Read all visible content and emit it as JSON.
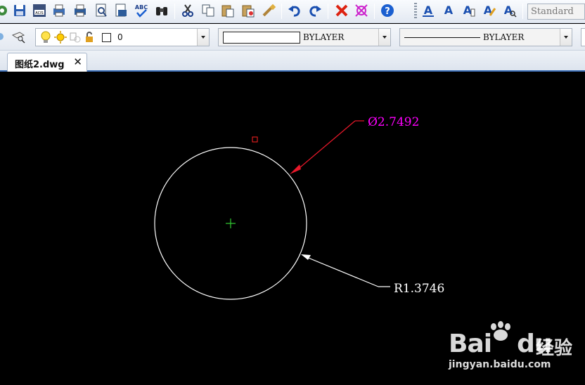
{
  "toolbar": {
    "text_style": "Standard",
    "icons": [
      "new-drawing-icon",
      "save-icon",
      "save-as-icon",
      "print-preview-icon",
      "print-icon",
      "preview-icon",
      "publish-icon",
      "spell-check-icon",
      "find-icon",
      "cut-icon",
      "copy-icon",
      "paste-icon",
      "paste-special-icon",
      "match-properties-icon",
      "undo-icon",
      "redo-icon",
      "erase-icon",
      "pick-icon",
      "help-icon",
      "text-style-icon",
      "text-icon",
      "edit-text-icon",
      "text-format-icon",
      "find-text-icon"
    ],
    "spell_label": "ABC"
  },
  "layer_bar": {
    "layer_name": "0",
    "color_value": "BYLAYER",
    "linetype_value": "BYLAYER"
  },
  "tabs": [
    {
      "label": "图纸2.dwg",
      "close": "✕"
    }
  ],
  "drawing": {
    "diameter_label": "Ø2.7492",
    "radius_label": "R1.3746",
    "circle_color": "#ffffff",
    "diameter_color": "#ff00ff",
    "leader_color": "#e8182a",
    "center_color": "#33cc33",
    "background": "#000000"
  },
  "watermark": {
    "brand": "Bai",
    "brand_suffix": "du",
    "cn_text": "经验",
    "url": "jingyan.baidu.com"
  }
}
